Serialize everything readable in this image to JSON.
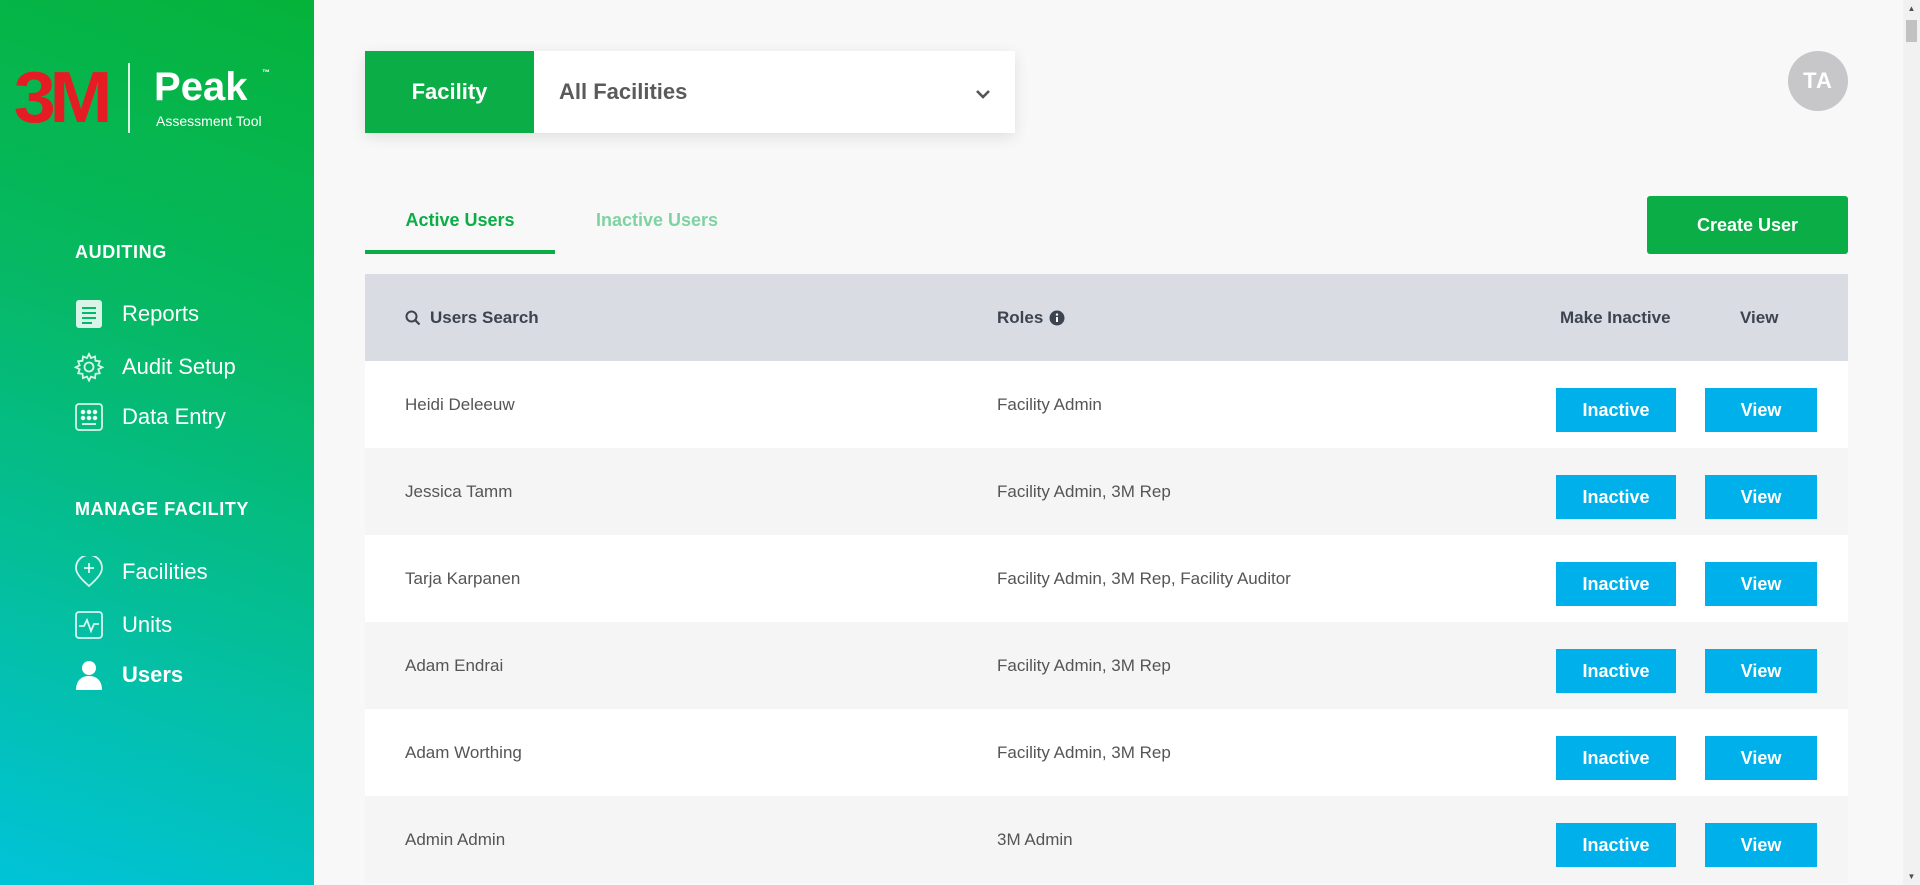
{
  "brand": {
    "logo": "3M",
    "product": "Peak",
    "trademark": "™",
    "subtitle": "Assessment Tool"
  },
  "sidebar": {
    "sections": [
      {
        "title": "AUDITING",
        "items": [
          {
            "label": "Reports",
            "icon": "report-icon"
          },
          {
            "label": "Audit Setup",
            "icon": "gear-icon"
          },
          {
            "label": "Data Entry",
            "icon": "keypad-icon"
          }
        ]
      },
      {
        "title": "MANAGE FACILITY",
        "items": [
          {
            "label": "Facilities",
            "icon": "add-location-icon"
          },
          {
            "label": "Units",
            "icon": "pulse-icon"
          },
          {
            "label": "Users",
            "icon": "user-icon",
            "active": true
          }
        ]
      }
    ]
  },
  "facility": {
    "label": "Facility",
    "selected": "All Facilities"
  },
  "avatar": {
    "initials": "TA"
  },
  "tabs": [
    {
      "label": "Active Users",
      "active": true
    },
    {
      "label": "Inactive Users",
      "active": false
    }
  ],
  "create_user_label": "Create User",
  "table": {
    "headers": {
      "search": "Users Search",
      "roles": "Roles",
      "make_inactive": "Make Inactive",
      "view": "View"
    },
    "rows": [
      {
        "name": "Heidi Deleeuw",
        "roles": "Facility Admin",
        "inactive_label": "Inactive",
        "view_label": "View"
      },
      {
        "name": "Jessica Tamm",
        "roles": "Facility Admin, 3M Rep",
        "inactive_label": "Inactive",
        "view_label": "View"
      },
      {
        "name": "Tarja Karpanen",
        "roles": "Facility Admin, 3M Rep, Facility Auditor",
        "inactive_label": "Inactive",
        "view_label": "View"
      },
      {
        "name": "Adam Endrai",
        "roles": "Facility Admin, 3M Rep",
        "inactive_label": "Inactive",
        "view_label": "View"
      },
      {
        "name": "Adam Worthing",
        "roles": "Facility Admin, 3M Rep",
        "inactive_label": "Inactive",
        "view_label": "View"
      },
      {
        "name": "Admin Admin",
        "roles": "3M Admin",
        "inactive_label": "Inactive",
        "view_label": "View"
      }
    ]
  },
  "colors": {
    "brand_green": "#0bae46",
    "action_blue": "#00b0eb",
    "logo_red": "#e51c23",
    "header_gray": "#d9dce2"
  }
}
